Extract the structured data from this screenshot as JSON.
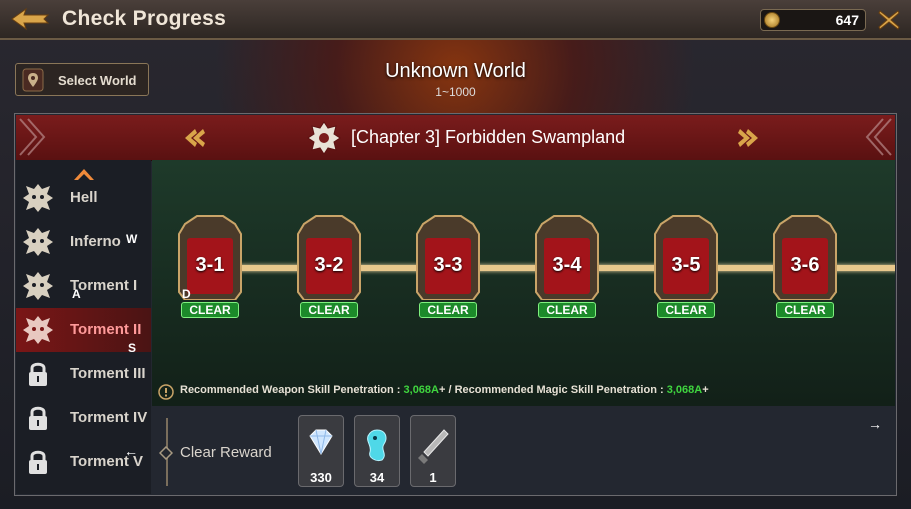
{
  "header": {
    "title": "Check Progress",
    "currency_value": "647"
  },
  "world": {
    "select_label": "Select World",
    "name": "Unknown World",
    "range": "1~1000"
  },
  "chapter": {
    "title": "[Chapter 3] Forbidden Swampland"
  },
  "difficulties": [
    {
      "label": "Hell",
      "locked": false
    },
    {
      "label": "Inferno",
      "locked": false
    },
    {
      "label": "Torment I",
      "locked": false
    },
    {
      "label": "Torment II",
      "locked": false,
      "active": true
    },
    {
      "label": "Torment III",
      "locked": true
    },
    {
      "label": "Torment IV",
      "locked": true
    },
    {
      "label": "Torment V",
      "locked": true
    }
  ],
  "stages": [
    {
      "label": "3-1",
      "status": "CLEAR"
    },
    {
      "label": "3-2",
      "status": "CLEAR"
    },
    {
      "label": "3-3",
      "status": "CLEAR"
    },
    {
      "label": "3-4",
      "status": "CLEAR"
    },
    {
      "label": "3-5",
      "status": "CLEAR"
    },
    {
      "label": "3-6",
      "status": "CLEAR"
    }
  ],
  "recommendation": {
    "weapon_label": "Recommended Weapon Skill Penetration : ",
    "weapon_value": "3,068A",
    "separator": "+ / Recommended Magic Skill Penetration : ",
    "magic_value": "3,068A",
    "suffix": "+"
  },
  "reward": {
    "label": "Clear Reward",
    "items": [
      {
        "icon": "diamond-icon",
        "qty": "330"
      },
      {
        "icon": "spirit-icon",
        "qty": "34"
      },
      {
        "icon": "weapon-icon",
        "qty": "1"
      }
    ]
  },
  "overlay_keys": {
    "w": "W",
    "a": "A",
    "s": "S",
    "d": "D",
    "left": "←",
    "right": "→"
  },
  "colors": {
    "accent_red": "#7a1c1c",
    "clear_green": "#1c8a2a",
    "rec_green": "#3fd53f"
  }
}
